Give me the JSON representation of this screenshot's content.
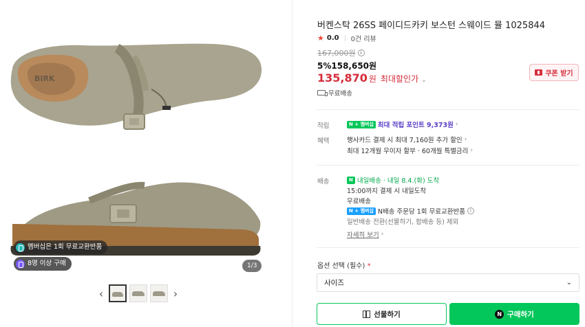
{
  "gallery": {
    "badges": [
      "멤버십은 1회 무료교환반품",
      "8명 이상 구매"
    ],
    "page_counter": "1/3",
    "prev_icon": "chevron-left-icon",
    "next_icon": "chevron-right-icon",
    "thumb_count": 3
  },
  "product": {
    "title": "버켄스탁 26SS 페이디드카키 보스턴 스웨이드 뮬 1025844",
    "rating": "0.0",
    "review_count": "0건 리뷰",
    "original_price": "167,000원",
    "sale": "5%158,650원",
    "max_discount_price": "135,870",
    "max_discount_unit": "원",
    "max_discount_label": "최대할인가",
    "coupon_label": "쿠폰 받기",
    "shipping_free": "무료배송"
  },
  "benefits": {
    "points_label": "적립",
    "points_badge": "N + 멤버십",
    "points_text": "최대 적립 포인트 9,373원",
    "card_label": "혜택",
    "card_line1": "행사카드 결제 시 최대 7,160원 추가 할인",
    "card_line2": "최대 12개월 무이자 할부 · 60개월 특별금리"
  },
  "delivery": {
    "label": "배송",
    "badge": "N",
    "today_label": "내일배송",
    "arrival": "· 내일 8.4.(화) 도착",
    "cutoff": "15:00까지 결제 시 내일도착",
    "fee": "무료배송",
    "exchange_badge": "N + 멤버십",
    "exchange": "N배송 주문당 1회 무료교환반품",
    "exclusion": "일반배송 전환(선물하기, 합배송 등) 제외",
    "more_link": "자세히 보기"
  },
  "options": {
    "label": "옵션 선택 (필수)",
    "required_mark": "*",
    "select_value": "사이즈"
  },
  "actions": {
    "gift_label": "선물하기",
    "buy_label": "구매하기"
  },
  "colors": {
    "accent_green": "#03c75a",
    "price_red": "#d62d3b",
    "membership_purple": "#5b3ec8"
  }
}
